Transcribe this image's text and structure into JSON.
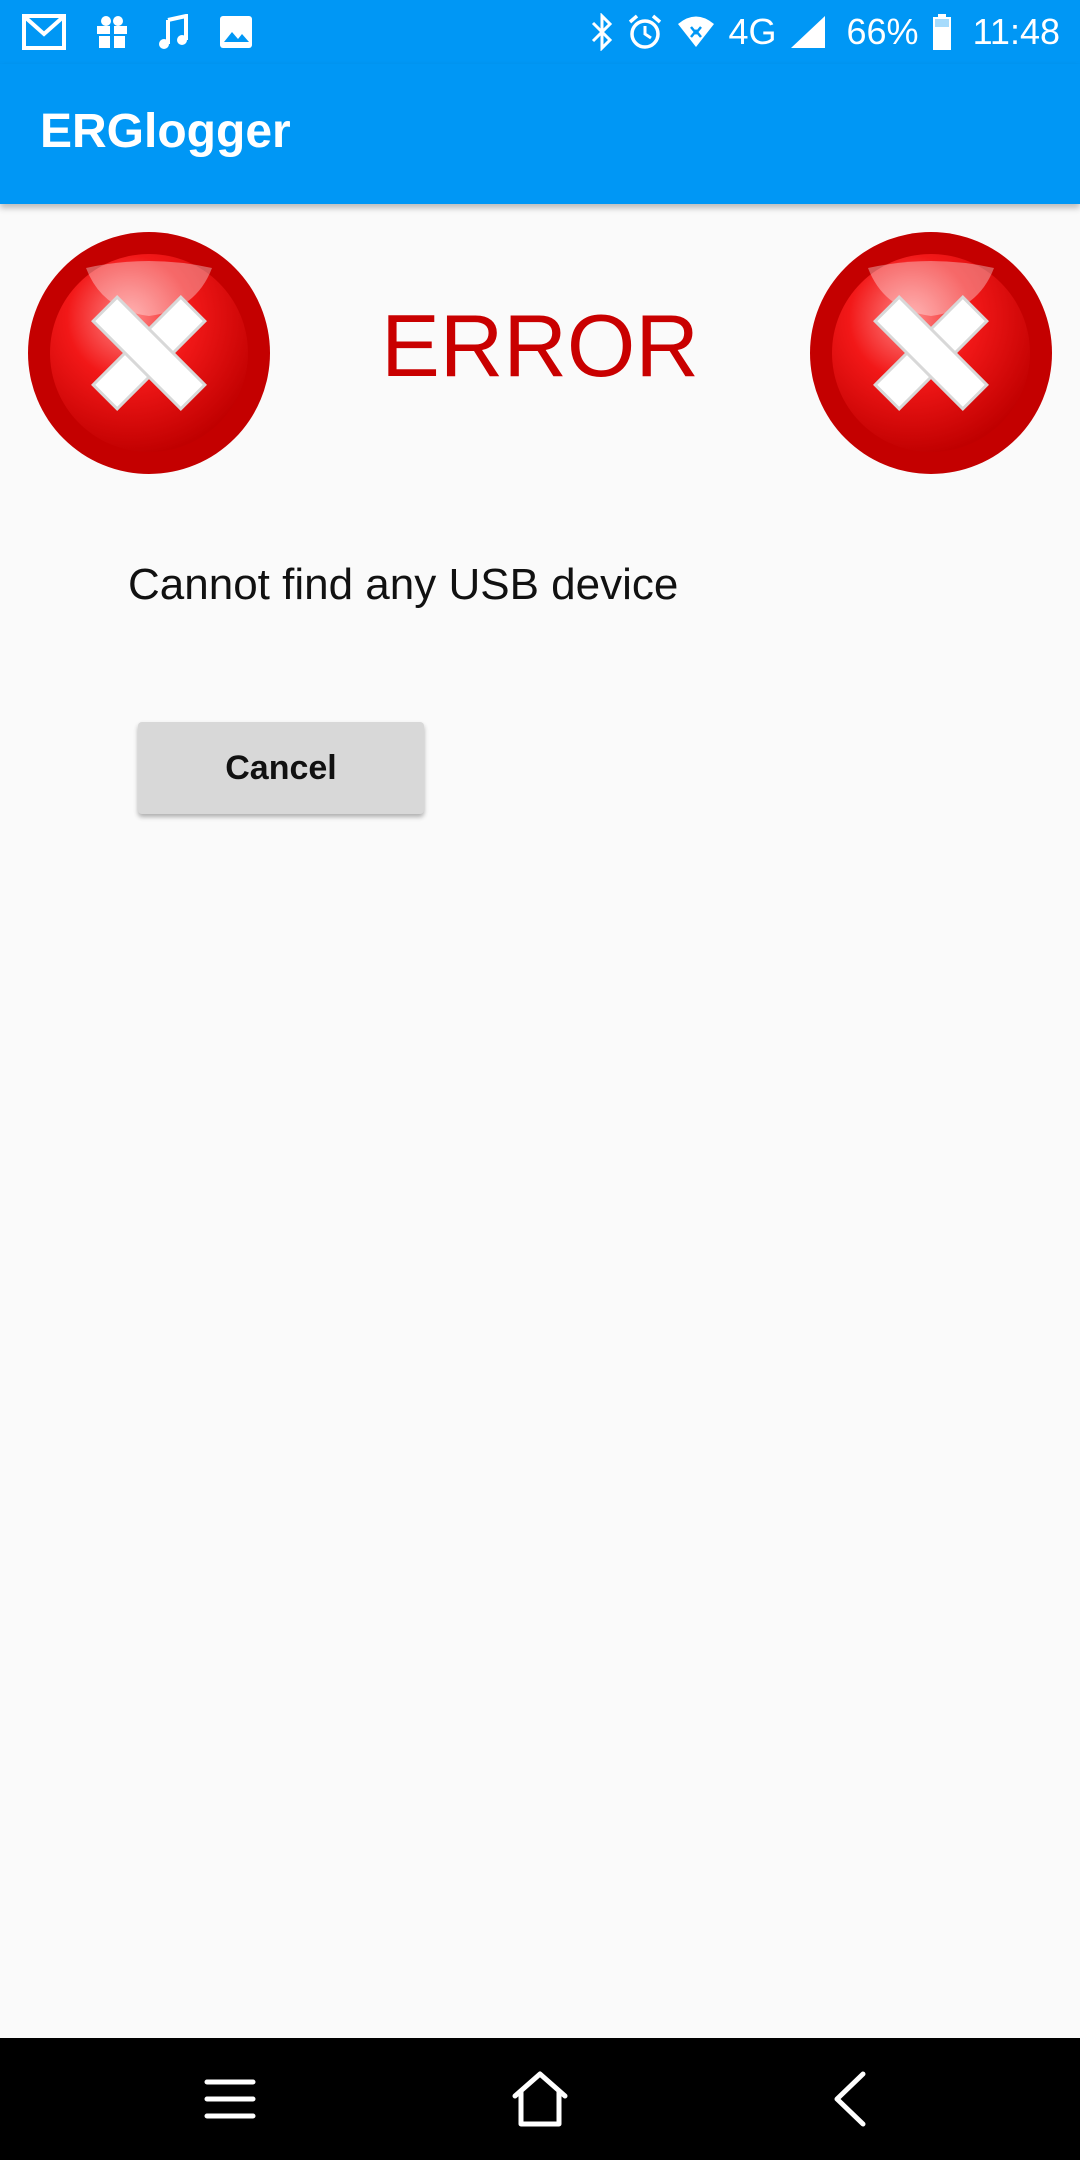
{
  "status_bar": {
    "left_icons": [
      "gmail-icon",
      "gift-icon",
      "music-icon",
      "image-icon"
    ],
    "right_icons": [
      "bluetooth-icon",
      "alarm-icon",
      "wifi-icon",
      "network-4g-icon",
      "signal-icon",
      "battery-icon"
    ],
    "network_label": "4G",
    "battery": "66%",
    "time": "11:48"
  },
  "app_bar": {
    "title": "ERGlogger"
  },
  "content": {
    "heading": "ERROR",
    "message": "Cannot find any USB device",
    "cancel_label": "Cancel"
  },
  "nav_bar": {
    "buttons": [
      "menu-icon",
      "home-icon",
      "back-icon"
    ]
  },
  "colors": {
    "primary": "#0097f5",
    "error_red": "#c90000",
    "background": "#fafafa",
    "button_gray": "#d8d8d8"
  }
}
